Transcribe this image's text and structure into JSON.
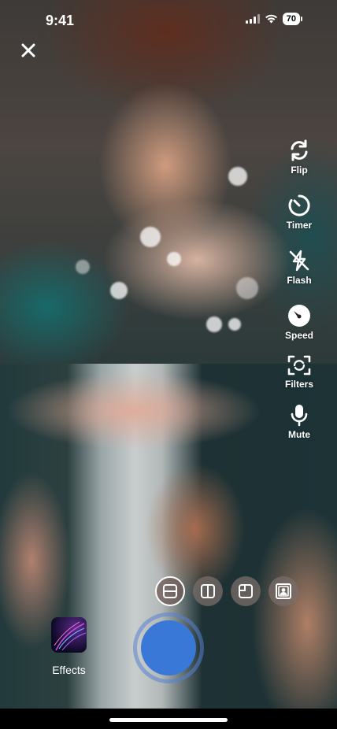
{
  "status_bar": {
    "time": "9:41",
    "battery": "70"
  },
  "tools": [
    {
      "id": "flip",
      "label": "Flip",
      "icon": "flip-icon"
    },
    {
      "id": "timer",
      "label": "Timer",
      "icon": "timer-icon"
    },
    {
      "id": "flash",
      "label": "Flash",
      "icon": "flash-off-icon"
    },
    {
      "id": "speed",
      "label": "Speed",
      "icon": "speed-icon"
    },
    {
      "id": "filters",
      "label": "Filters",
      "icon": "filters-icon"
    },
    {
      "id": "mute",
      "label": "Mute",
      "icon": "microphone-icon"
    }
  ],
  "layouts": [
    {
      "id": "split-horizontal",
      "icon": "layout-split-horizontal-icon",
      "active": true
    },
    {
      "id": "split-vertical",
      "icon": "layout-split-vertical-icon",
      "active": false
    },
    {
      "id": "picture-in-picture",
      "icon": "layout-pip-icon",
      "active": false
    },
    {
      "id": "portrait-frame",
      "icon": "layout-portrait-icon",
      "active": false
    }
  ],
  "effects": {
    "label": "Effects"
  },
  "colors": {
    "shutter": "#3a78d8",
    "shutter_ring": "#5582d2"
  }
}
